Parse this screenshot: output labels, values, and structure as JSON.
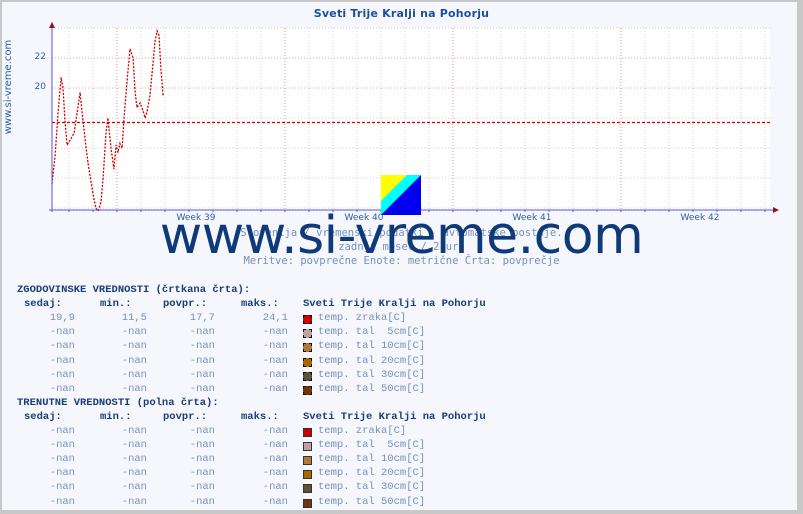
{
  "chart_data": {
    "type": "line",
    "title": "Sveti Trije Kralji na Pohorju",
    "xlabel": "",
    "ylabel": "",
    "side_label": "www.si-vreme.com",
    "x_unit": "days since start of plot",
    "xlim": [
      0,
      30
    ],
    "ylim": [
      11.8,
      24.3
    ],
    "y_ticks": [
      22,
      20
    ],
    "y_tick_labels": [
      "22",
      "20"
    ],
    "y_grid": [
      24,
      22,
      20,
      18,
      16,
      14,
      12
    ],
    "x_ticks": [
      {
        "label": "Week 39",
        "day": 6
      },
      {
        "label": "Week 40",
        "day": 13
      },
      {
        "label": "Week 41",
        "day": 20
      },
      {
        "label": "Week 42",
        "day": 27
      }
    ],
    "week_boundaries": [
      2.7,
      9.7,
      16.7,
      23.7
    ],
    "grid": true,
    "series": [
      {
        "name": "temp. zraka[C] (zgodovinske)",
        "style": "dashed",
        "color": "#cc0000",
        "x": [
          0,
          0.13,
          0.25,
          0.38,
          0.46,
          0.54,
          0.63,
          0.75,
          0.92,
          1.04,
          1.17,
          1.29,
          1.42,
          1.5,
          1.63,
          1.75,
          1.83,
          1.92,
          2.04,
          2.13,
          2.25,
          2.33,
          2.46,
          2.58,
          2.67,
          2.75,
          2.83,
          2.92,
          3.0,
          3.13,
          3.25,
          3.38,
          3.46,
          3.54,
          3.67,
          3.79,
          3.88,
          3.96,
          4.08,
          4.17,
          4.29,
          4.38,
          4.46,
          4.54,
          4.63
        ],
        "values": [
          13.6,
          15.5,
          18.3,
          20.7,
          20.0,
          17.8,
          16.2,
          16.5,
          17.0,
          18.3,
          19.7,
          17.8,
          16.0,
          15.0,
          13.7,
          12.6,
          12.0,
          11.8,
          12.4,
          14.0,
          17.0,
          18.0,
          16.0,
          14.6,
          16.2,
          15.7,
          16.3,
          16.0,
          18.0,
          20.5,
          22.6,
          22.0,
          19.8,
          18.7,
          19.0,
          18.5,
          18.0,
          18.4,
          19.5,
          21.0,
          23.1,
          23.8,
          23.5,
          21.2,
          19.5
        ]
      },
      {
        "name": "povprečje (average)",
        "style": "dotted-horizontal",
        "color": "#cc0000",
        "value": 17.7
      }
    ]
  },
  "page": {
    "title": "Sveti Trije Kralji na Pohorju",
    "watermark": "www.si-vreme.com",
    "subtitle_lines": [
      "Slovenija / vremenski podatki - avtomatske postaje.",
      "zadnji mesec / 2 uri",
      "Meritve: povprečne  Enote: metrične  Črta: povprečje"
    ]
  },
  "tables": [
    {
      "heading": "ZGODOVINSKE VREDNOSTI (črtkana črta):",
      "columns": [
        "sedaj:",
        "min.:",
        "povpr.:",
        "maks.:"
      ],
      "station": "Sveti Trije Kralji na Pohorju",
      "swatch_style": "dashed",
      "rows": [
        {
          "sedaj": "19,9",
          "min": "11,5",
          "povpr": "17,7",
          "maks": "24,1",
          "label": "temp. zraka[C]",
          "color": "#cc0000"
        },
        {
          "sedaj": "-nan",
          "min": "-nan",
          "povpr": "-nan",
          "maks": "-nan",
          "label": "temp. tal  5cm[C]",
          "color": "#c0a0a0"
        },
        {
          "sedaj": "-nan",
          "min": "-nan",
          "povpr": "-nan",
          "maks": "-nan",
          "label": "temp. tal 10cm[C]",
          "color": "#b07838"
        },
        {
          "sedaj": "-nan",
          "min": "-nan",
          "povpr": "-nan",
          "maks": "-nan",
          "label": "temp. tal 20cm[C]",
          "color": "#a86800"
        },
        {
          "sedaj": "-nan",
          "min": "-nan",
          "povpr": "-nan",
          "maks": "-nan",
          "label": "temp. tal 30cm[C]",
          "color": "#605038"
        },
        {
          "sedaj": "-nan",
          "min": "-nan",
          "povpr": "-nan",
          "maks": "-nan",
          "label": "temp. tal 50cm[C]",
          "color": "#703808"
        }
      ]
    },
    {
      "heading": "TRENUTNE VREDNOSTI (polna črta):",
      "columns": [
        "sedaj:",
        "min.:",
        "povpr.:",
        "maks.:"
      ],
      "station": "Sveti Trije Kralji na Pohorju",
      "swatch_style": "solid",
      "rows": [
        {
          "sedaj": "-nan",
          "min": "-nan",
          "povpr": "-nan",
          "maks": "-nan",
          "label": "temp. zraka[C]",
          "color": "#cc0000"
        },
        {
          "sedaj": "-nan",
          "min": "-nan",
          "povpr": "-nan",
          "maks": "-nan",
          "label": "temp. tal  5cm[C]",
          "color": "#c0a0a0"
        },
        {
          "sedaj": "-nan",
          "min": "-nan",
          "povpr": "-nan",
          "maks": "-nan",
          "label": "temp. tal 10cm[C]",
          "color": "#b07838"
        },
        {
          "sedaj": "-nan",
          "min": "-nan",
          "povpr": "-nan",
          "maks": "-nan",
          "label": "temp. tal 20cm[C]",
          "color": "#a86800"
        },
        {
          "sedaj": "-nan",
          "min": "-nan",
          "povpr": "-nan",
          "maks": "-nan",
          "label": "temp. tal 30cm[C]",
          "color": "#605038"
        },
        {
          "sedaj": "-nan",
          "min": "-nan",
          "povpr": "-nan",
          "maks": "-nan",
          "label": "temp. tal 50cm[C]",
          "color": "#703808"
        }
      ]
    }
  ]
}
